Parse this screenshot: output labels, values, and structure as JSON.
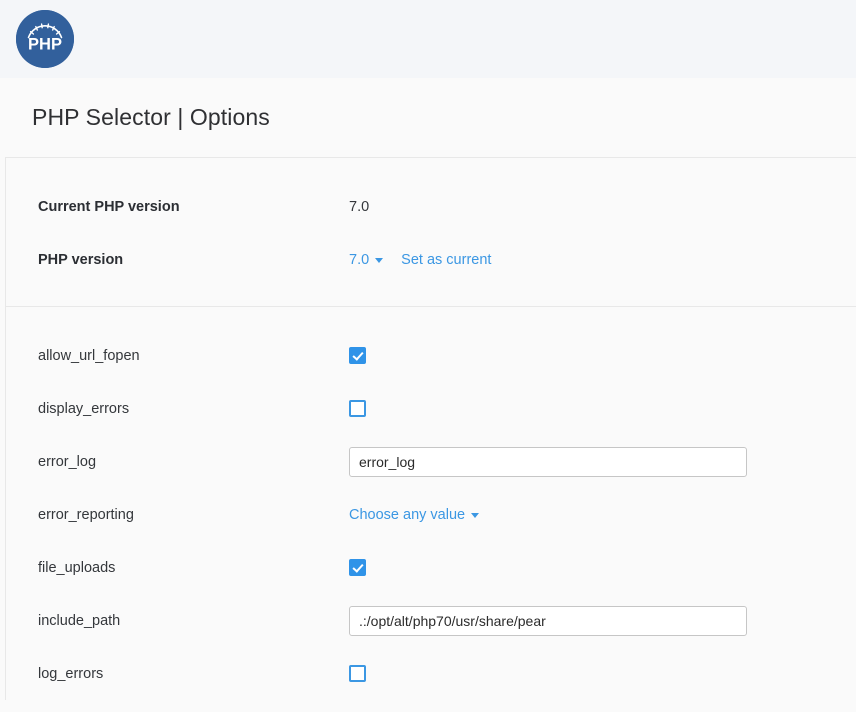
{
  "header": {
    "logo_icon": "php-gauge-logo",
    "logo_text": "PHP",
    "brand_color": "#32609c"
  },
  "page": {
    "title": "PHP Selector | Options"
  },
  "colors": {
    "link": "#3b97e3",
    "checkbox_on": "#2f93e8",
    "checkbox_border": "#3b97e3",
    "band": "#f4f6f9",
    "page_bg": "#fafafa",
    "border": "#e8e8e8"
  },
  "version_section": {
    "current_version": {
      "label": "Current PHP version",
      "value": "7.0"
    },
    "selector": {
      "label": "PHP version",
      "selected": "7.0",
      "caret_icon": "chevron-down-icon",
      "set_as_current_label": "Set as current"
    }
  },
  "options": [
    {
      "name": "allow_url_fopen",
      "type": "checkbox",
      "checked": true
    },
    {
      "name": "display_errors",
      "type": "checkbox",
      "checked": false
    },
    {
      "name": "error_log",
      "type": "text",
      "value": "error_log",
      "placeholder": ""
    },
    {
      "name": "error_reporting",
      "type": "dropdown",
      "value": "Choose any value",
      "caret_icon": "chevron-down-icon"
    },
    {
      "name": "file_uploads",
      "type": "checkbox",
      "checked": true
    },
    {
      "name": "include_path",
      "type": "text",
      "value": ".:/opt/alt/php70/usr/share/pear",
      "placeholder": ""
    },
    {
      "name": "log_errors",
      "type": "checkbox",
      "checked": false
    }
  ]
}
